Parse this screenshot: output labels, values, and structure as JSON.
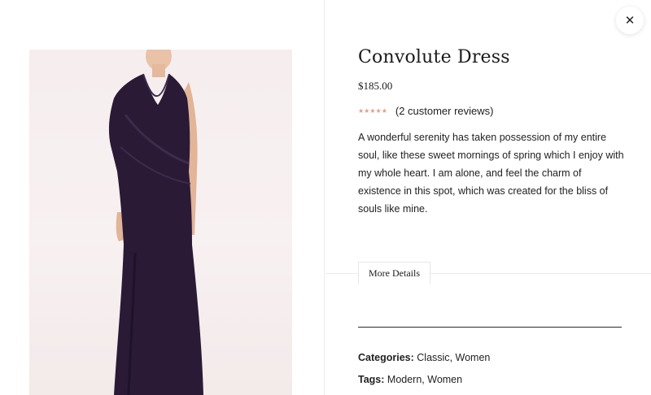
{
  "image": {
    "alt": "",
    "background_color": "#f6eeee",
    "dress_color": "#2a1a36"
  },
  "close": {
    "glyph": "✕",
    "icon": "close-icon"
  },
  "product": {
    "title": "Convolute Dress",
    "price": "$185.00",
    "rating": {
      "stars": "★★★★★",
      "value": 5,
      "max": 5,
      "reviews_label": "(2 customer reviews)"
    },
    "description": "A wonderful serenity has taken possession of my entire soul, like these sweet mornings of spring which I enjoy with my whole heart. I am alone, and feel the charm of existence in this spot, which was created for the bliss of souls like mine."
  },
  "tabs": {
    "more_details": "More Details"
  },
  "meta": {
    "categories_label": "Categories:",
    "categories": [
      {
        "label": "Classic"
      },
      {
        "label": "Women"
      }
    ],
    "tags_label": "Tags:",
    "tags": [
      {
        "label": "Modern"
      },
      {
        "label": "Women"
      }
    ],
    "separator": ", "
  },
  "colors": {
    "star": "#d9a08c",
    "text": "#222222",
    "rule": "#2a2a2a"
  }
}
